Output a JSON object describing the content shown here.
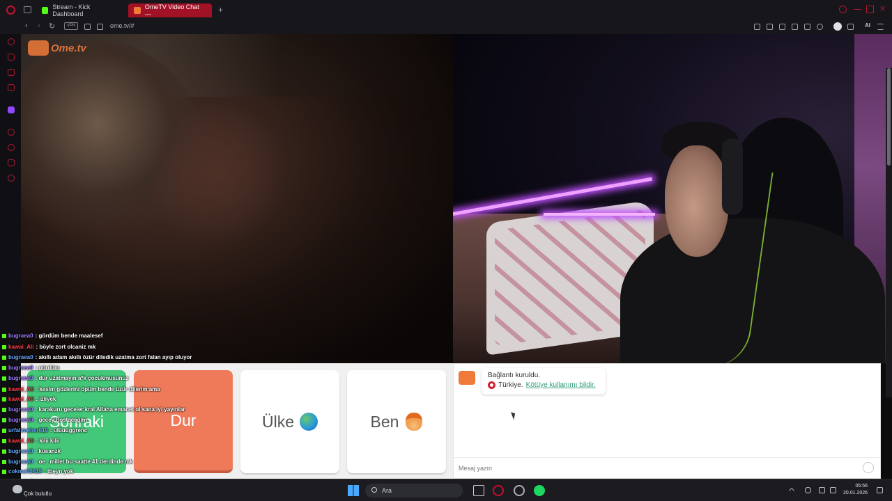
{
  "browser": {
    "tabs": [
      {
        "label": "Stream - Kick Dashboard",
        "active": false
      },
      {
        "label": "OmeTV Video Chat —",
        "active": true
      }
    ],
    "vpn_label": "VPN",
    "url": "ome.tv/#",
    "ai_label": "AI"
  },
  "video": {
    "logo_text": "Ome.tv"
  },
  "controls": {
    "next_label": "Sonraki",
    "stop_label": "Dur",
    "country_label": "Ülke",
    "me_label": "Ben"
  },
  "chat": {
    "status_message": "Bağlantı kuruldu.",
    "country": "Türkiye.",
    "report_link": "Kötüye kullanımı bildir.",
    "input_placeholder": "Mesaj yazın"
  },
  "stream_chat": [
    {
      "user": "bugraea0",
      "text": ": gördüm bende maalesef",
      "color": "purple"
    },
    {
      "user": "kawai_Ali",
      "text": ": böyle zort olcaniz mk",
      "color": "red"
    },
    {
      "user": "bugraea0",
      "text": ": akıllı adam akıllı özür diledik uzatma zort falan ayıp oluyor",
      "color": "blue"
    },
    {
      "user": "bugraea0",
      "text": ": gördüm",
      "color": "purple"
    },
    {
      "user": "bugraea0",
      "text": ": dur uzatmayın a*k çocukmusunuz",
      "color": "purple"
    },
    {
      "user": "kawai_Ali",
      "text": ": kesim gözlerini öpüm bende üzür dilerim ama",
      "color": "red"
    },
    {
      "user": "kawai_Ali",
      "text": ": izliyek",
      "color": "red"
    },
    {
      "user": "bugraea0",
      "text": ": karakuru geceler kral Allaha emanet ol sana iyi yayınlar",
      "color": "purple"
    },
    {
      "user": "bugraea0",
      "text": ": gecey bostacağım",
      "color": "purple"
    },
    {
      "user": "urfalimeher619",
      "text": ": ülüüüggrenc",
      "color": "blue"
    },
    {
      "user": "kawai_Ali",
      "text": ": kilii kilii",
      "color": "red"
    },
    {
      "user": "bugraea0",
      "text": ": kusanzk",
      "color": "blue"
    },
    {
      "user": "bugraea0",
      "text": ": oe . millet bu saatte 41 derdinde mk",
      "color": "blue"
    },
    {
      "user": "cokmeh0619",
      "text": ": tbeyn yok",
      "color": "blue"
    },
    {
      "user": "bugraea0",
      "text": ": geldi",
      "color": "purple"
    }
  ],
  "taskbar": {
    "weather": "Çok bulutlu",
    "search_label": "Ara",
    "time": "05:56",
    "date": "20.01.2026"
  },
  "colors": {
    "tab_active": "#a11226",
    "next_button": "#43c87a",
    "stop_button": "#ee7a5a",
    "link_color": "#2e9c7a",
    "accent_orange": "#f07a3a"
  }
}
